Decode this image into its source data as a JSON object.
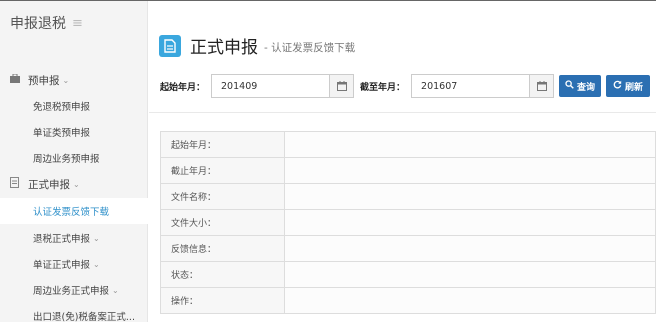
{
  "sidebar": {
    "header_title": "申报退税",
    "header_icon": "hamburger-icon",
    "items": [
      {
        "label": "预申报",
        "level": 1,
        "icon": "briefcase-icon",
        "caret": true
      },
      {
        "label": "免退税预申报",
        "level": 2
      },
      {
        "label": "单证类预申报",
        "level": 2
      },
      {
        "label": "周边业务预申报",
        "level": 2
      },
      {
        "label": "正式申报",
        "level": 1,
        "icon": "document-icon",
        "caret": true
      },
      {
        "label": "认证发票反馈下载",
        "level": 2,
        "active": true
      },
      {
        "label": "退税正式申报",
        "level": 2,
        "caret": true
      },
      {
        "label": "单证正式申报",
        "level": 2,
        "caret": true
      },
      {
        "label": "周边业务正式申报",
        "level": 2,
        "caret": true
      },
      {
        "label": "出口退(免)税备案正式...",
        "level": 2
      }
    ]
  },
  "page": {
    "title": "正式申报",
    "subtitle": "- 认证发票反馈下载"
  },
  "filter": {
    "start_label": "起始年月：",
    "start_value": "201409",
    "end_label": "截至年月：",
    "end_value": "201607",
    "query_label": "查询",
    "refresh_label": "刷新"
  },
  "table": {
    "rows": [
      {
        "label": "起始年月：",
        "value": ""
      },
      {
        "label": "截止年月：",
        "value": ""
      },
      {
        "label": "文件名称：",
        "value": ""
      },
      {
        "label": "文件大小：",
        "value": ""
      },
      {
        "label": "反馈信息：",
        "value": ""
      },
      {
        "label": "状态：",
        "value": ""
      },
      {
        "label": "操作：",
        "value": ""
      }
    ]
  },
  "colors": {
    "accent_blue": "#2b6fb2",
    "title_icon_blue": "#3aa7de",
    "active_link": "#2d8fc9"
  }
}
